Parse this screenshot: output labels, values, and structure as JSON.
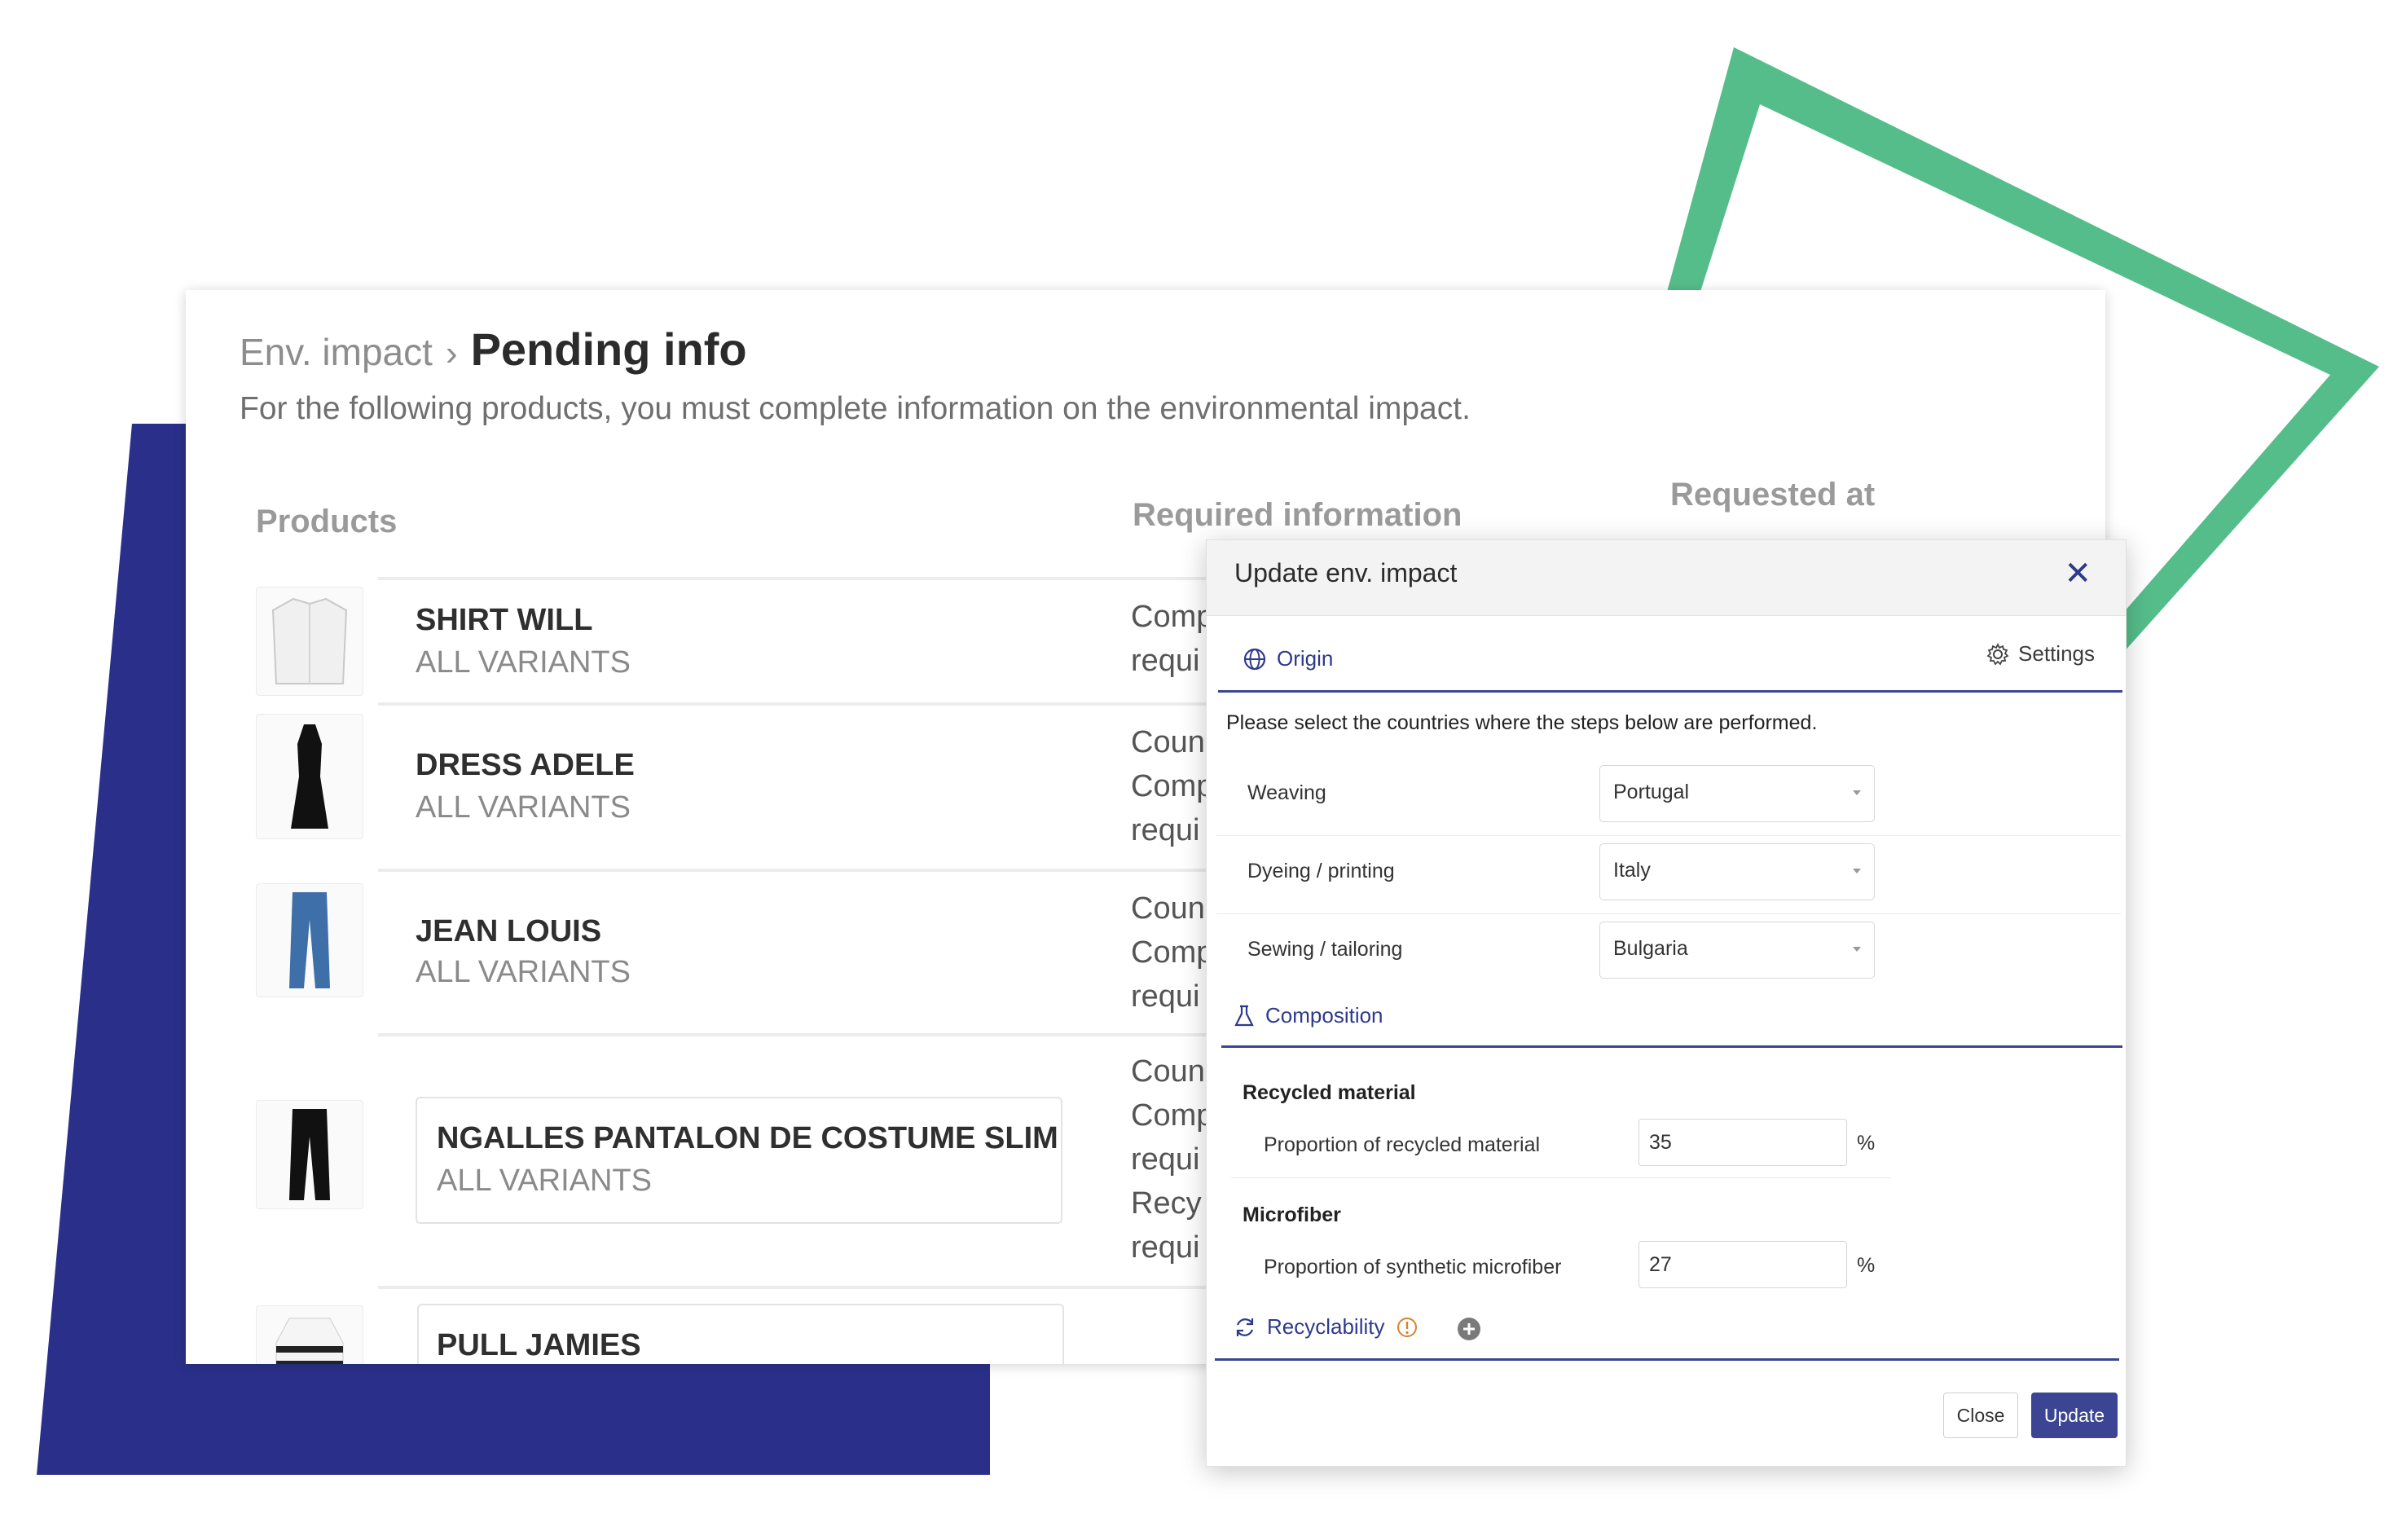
{
  "breadcrumb": {
    "parent": "Env. impact",
    "separator": "›",
    "current": "Pending info"
  },
  "subtitle": "For the following products, you must complete information on the environmental impact.",
  "table": {
    "headers": {
      "products": "Products",
      "required": "Required information",
      "requested": "Requested at"
    },
    "rows": [
      {
        "name": "SHIRT WILL",
        "variant": "ALL VARIANTS",
        "required": [
          "Comp",
          "requi"
        ]
      },
      {
        "name": "DRESS ADELE",
        "variant": "ALL VARIANTS",
        "required": [
          "Coun",
          "Comp",
          "requi"
        ]
      },
      {
        "name": "JEAN LOUIS",
        "variant": "ALL VARIANTS",
        "required": [
          "Coun",
          "Comp",
          "requi"
        ]
      },
      {
        "name": "NGALLES PANTALON DE COSTUME SLIM",
        "variant": "ALL VARIANTS",
        "required": [
          "Coun",
          "Comp",
          "requi",
          "Recy",
          "requi"
        ]
      },
      {
        "name": "PULL JAMIES"
      }
    ]
  },
  "modal": {
    "title": "Update env. impact",
    "close_icon": "close-icon",
    "origin_tab": "Origin",
    "settings_label": "Settings",
    "instruction": "Please select the countries where the steps below are performed.",
    "origin_fields": [
      {
        "label": "Weaving",
        "value": "Portugal"
      },
      {
        "label": "Dyeing / printing",
        "value": "Italy"
      },
      {
        "label": "Sewing / tailoring",
        "value": "Bulgaria"
      }
    ],
    "composition_tab": "Composition",
    "recycled_group": "Recycled material",
    "recycled_label": "Proportion of recycled material",
    "recycled_value": "35",
    "microfiber_group": "Microfiber",
    "microfiber_label": "Proportion of synthetic microfiber",
    "microfiber_value": "27",
    "unit": "%",
    "recyclability_tab": "Recyclability",
    "close_button": "Close",
    "update_button": "Update"
  },
  "colors": {
    "accent": "#3b4593",
    "deco_blue": "#2a3089",
    "deco_green": "#55bd8a"
  }
}
